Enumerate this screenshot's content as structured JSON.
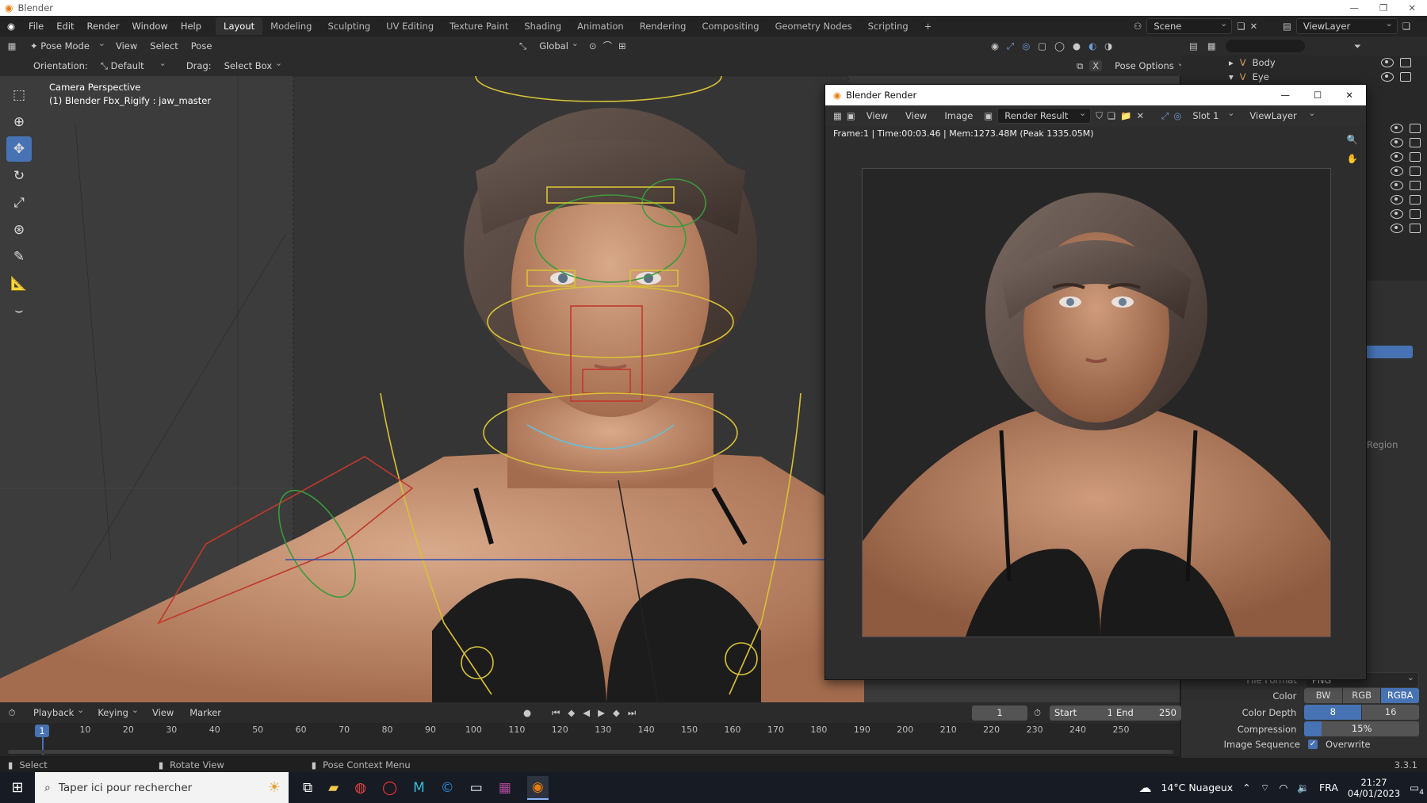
{
  "window_title": "Blender",
  "menu": [
    "File",
    "Edit",
    "Render",
    "Window",
    "Help"
  ],
  "workspaces": [
    "Layout",
    "Modeling",
    "Sculpting",
    "UV Editing",
    "Texture Paint",
    "Shading",
    "Animation",
    "Rendering",
    "Compositing",
    "Geometry Nodes",
    "Scripting"
  ],
  "active_workspace": "Layout",
  "scene": "Scene",
  "view_layer": "ViewLayer",
  "viewport_header": {
    "mode": "Pose Mode",
    "menus": [
      "View",
      "Select",
      "Pose"
    ],
    "transform_orientation": "Global"
  },
  "tool_settings": {
    "orientation_label": "Orientation:",
    "orientation_value": "Default",
    "drag_label": "Drag:",
    "drag_value": "Select Box",
    "pose_options": "Pose Options"
  },
  "viewport_overlay": {
    "line1": "Camera Perspective",
    "line2": "(1) Blender Fbx_Rigify : jaw_master"
  },
  "outliner": {
    "items": [
      {
        "label": "Body",
        "icon": "armature-icon"
      },
      {
        "label": "Eye",
        "icon": "armature-icon"
      }
    ]
  },
  "render_window": {
    "title": "Blender Render",
    "menus": [
      "View",
      "View",
      "Image"
    ],
    "image_name": "Render Result",
    "slot": "Slot 1",
    "view_layer": "ViewLayer",
    "info": "Frame:1 | Time:00:03.46 | Mem:1273.48M (Peak 1335.05M)"
  },
  "properties": {
    "region_label": "Region",
    "file_format_label": "File Format",
    "file_format_value": "PNG",
    "color_label": "Color",
    "color_options": [
      "BW",
      "RGB",
      "RGBA"
    ],
    "color_selected": "RGBA",
    "color_depth_label": "Color Depth",
    "color_depth_options": [
      "8",
      "16"
    ],
    "color_depth_selected": "8",
    "compression_label": "Compression",
    "compression_value": "15%",
    "compression_fraction": 0.15,
    "image_sequence_label": "Image Sequence",
    "overwrite_label": "Overwrite",
    "overwrite_checked": true
  },
  "timeline": {
    "menus": [
      "Playback",
      "Keying",
      "View",
      "Marker"
    ],
    "current_frame": "1",
    "start_label": "Start",
    "start_value": "1",
    "end_label": "End",
    "end_value": "250",
    "ticks": [
      "1",
      "10",
      "20",
      "30",
      "40",
      "50",
      "60",
      "70",
      "80",
      "90",
      "100",
      "110",
      "120",
      "130",
      "140",
      "150",
      "160",
      "170",
      "180",
      "190",
      "200",
      "210",
      "220",
      "230",
      "240",
      "250"
    ]
  },
  "statusbar": {
    "select": "Select",
    "rotate_view": "Rotate View",
    "pose_context_menu": "Pose Context Menu",
    "version": "3.3.1"
  },
  "taskbar": {
    "search_placeholder": "Taper ici pour rechercher",
    "weather": "14°C  Nuageux",
    "language": "FRA",
    "time": "21:27",
    "date": "04/01/2023",
    "notifications": "4"
  },
  "colors": {
    "accent": "#4772b3",
    "ui_dark": "#1d1d1d",
    "viewport": "#3c3c3c",
    "bone_yellow": "#d8c236",
    "bone_red": "#c0392b",
    "bone_green": "#3c9a3c"
  }
}
